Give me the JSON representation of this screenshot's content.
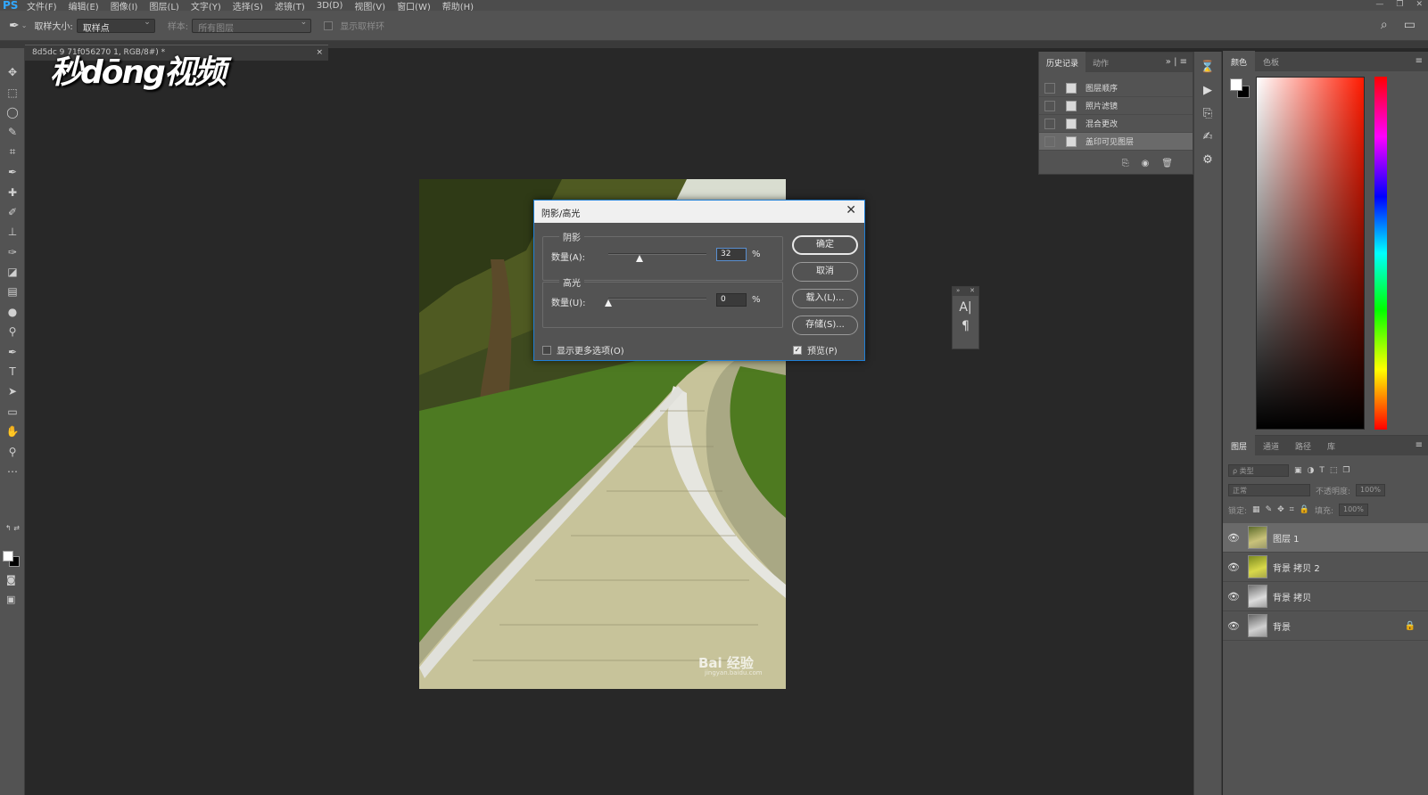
{
  "app": {
    "logo": "PS"
  },
  "menu": [
    "文件(F)",
    "编辑(E)",
    "图像(I)",
    "图层(L)",
    "文字(Y)",
    "选择(S)",
    "滤镜(T)",
    "3D(D)",
    "视图(V)",
    "窗口(W)",
    "帮助(H)"
  ],
  "options_bar": {
    "sample_size_label": "取样大小:",
    "sample_size_value": "取样点",
    "sample_label": "样本:",
    "sample_value": "所有图层",
    "show_ring_label": "显示取样环"
  },
  "document": {
    "tab_title": "8d5dc          9  71f056270           1, RGB/8#) *",
    "close_glyph": "×",
    "watermark": "秒dōng视频",
    "image_watermark": "Bai 经验",
    "image_url": "jingyan.baidu.com"
  },
  "dialog": {
    "title": "阴影/高光",
    "shadows": {
      "group_label": "阴影",
      "amount_label": "数量(A):",
      "value": "32",
      "unit": "%",
      "slider_fraction": 0.32
    },
    "highlights": {
      "group_label": "高光",
      "amount_label": "数量(U):",
      "value": "0",
      "unit": "%",
      "slider_fraction": 0.0
    },
    "buttons": {
      "ok": "确定",
      "cancel": "取消",
      "load": "载入(L)...",
      "save": "存储(S)..."
    },
    "more_options_label": "显示更多选项(O)",
    "more_options_checked": false,
    "preview_label": "预览(P)",
    "preview_checked": true
  },
  "history_panel": {
    "tabs": [
      "历史记录",
      "动作"
    ],
    "active_tab": 0,
    "items": [
      "图层顺序",
      "照片滤镜",
      "混合更改",
      "盖印可见图层"
    ],
    "selected_index": 3
  },
  "color_panel": {
    "tabs": [
      "颜色",
      "色板"
    ],
    "active_tab": 0,
    "foreground": "#ffffff",
    "background": "#000000",
    "hue": "#ff1a00"
  },
  "layers_panel": {
    "tabs": [
      "图层",
      "通道",
      "路径",
      "库"
    ],
    "active_tab": 0,
    "filter_placeholder": "ρ 类型",
    "blend_mode": "正常",
    "opacity_label": "不透明度:",
    "opacity_value": "100%",
    "lock_label": "锁定:",
    "fill_label": "填充:",
    "fill_value": "100%",
    "layers": [
      {
        "name": "图层 1",
        "visible": true,
        "locked": false
      },
      {
        "name": "背景 拷贝 2",
        "visible": true,
        "locked": false
      },
      {
        "name": "背景 拷贝",
        "visible": true,
        "locked": false
      },
      {
        "name": "背景",
        "visible": true,
        "locked": true
      }
    ],
    "selected_index": 0
  },
  "character_panel": {
    "icons": [
      "character-icon",
      "paragraph-icon"
    ]
  }
}
